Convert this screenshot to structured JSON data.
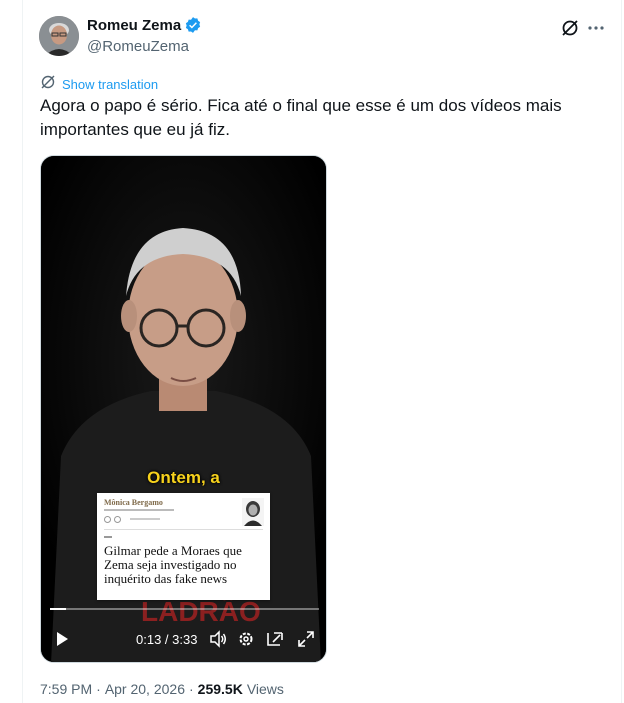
{
  "author": {
    "name": "Romeu Zema",
    "handle": "@RomeuZema",
    "verified_color": "#1d9bf0"
  },
  "header_icons": [
    "grok-icon",
    "more-icon"
  ],
  "translation": {
    "label": "Show translation",
    "icon": "translate-icon"
  },
  "tweet": {
    "text": "Agora o papo é sério. Fica até o final que esse é um dos vídeos mais importantes que eu já fiz."
  },
  "video": {
    "caption": "Ontem, a",
    "article": {
      "author": "Mônica Bergamo",
      "headline": "Gilmar pede a Moraes que Zema seja investigado no inquérito das fake news"
    },
    "current_time": "0:13",
    "duration": "3:33",
    "time_display": "0:13 / 3:33",
    "progress_fraction": 0.06,
    "controls": [
      "play-icon",
      "volume-icon",
      "settings-icon",
      "pip-icon",
      "fullscreen-icon"
    ]
  },
  "meta": {
    "time": "7:59 PM",
    "date": "Apr 20, 2026",
    "views_count": "259.5K",
    "views_label": "Views",
    "separator": "·"
  }
}
